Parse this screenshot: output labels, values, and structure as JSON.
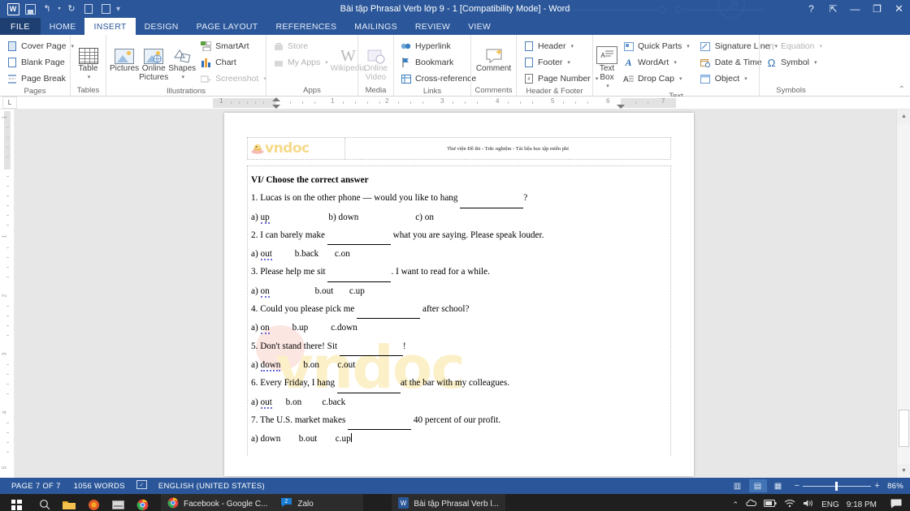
{
  "titlebar": {
    "doc_title": "Bài tập Phrasal Verb lớp 9 - 1 [Compatibility Mode] - Word",
    "qat": [
      {
        "name": "word-logo-icon",
        "label": "W"
      },
      {
        "name": "save-icon",
        "label": ""
      },
      {
        "name": "undo-icon",
        "label": "↰"
      },
      {
        "name": "redo-icon",
        "label": "↻"
      },
      {
        "name": "new-document-icon",
        "label": "🗋"
      },
      {
        "name": "print-preview-icon",
        "label": "🔍"
      },
      {
        "name": "customize-qat-icon",
        "label": "▾"
      }
    ],
    "window_buttons": [
      {
        "name": "help-button",
        "label": "?"
      },
      {
        "name": "ribbon-display-options-button",
        "label": "⇱"
      },
      {
        "name": "minimize-button",
        "label": "—"
      },
      {
        "name": "restore-button",
        "label": "❐"
      },
      {
        "name": "close-button",
        "label": "✕"
      }
    ]
  },
  "tabs": [
    {
      "label": "FILE",
      "active": false
    },
    {
      "label": "HOME",
      "active": false
    },
    {
      "label": "INSERT",
      "active": true
    },
    {
      "label": "DESIGN",
      "active": false
    },
    {
      "label": "PAGE LAYOUT",
      "active": false
    },
    {
      "label": "REFERENCES",
      "active": false
    },
    {
      "label": "MAILINGS",
      "active": false
    },
    {
      "label": "REVIEW",
      "active": false
    },
    {
      "label": "VIEW",
      "active": false
    }
  ],
  "ribbon": {
    "groups": [
      {
        "label": "Pages",
        "items": [
          {
            "label": "Cover Page",
            "caret": true,
            "icon": "cover-page-icon",
            "disabled": false
          },
          {
            "label": "Blank Page",
            "caret": false,
            "icon": "blank-page-icon",
            "disabled": false
          },
          {
            "label": "Page Break",
            "caret": false,
            "icon": "page-break-icon",
            "disabled": false
          }
        ]
      },
      {
        "label": "Tables",
        "items": [
          {
            "label": "Table",
            "caret": true,
            "icon": "table-icon",
            "disabled": false
          }
        ]
      },
      {
        "label": "Illustrations",
        "items": [
          {
            "label": "Pictures",
            "caret": false,
            "icon": "pictures-icon",
            "disabled": false
          },
          {
            "label": "Online Pictures",
            "caret": false,
            "icon": "online-pictures-icon",
            "disabled": false
          },
          {
            "label": "Shapes",
            "caret": true,
            "icon": "shapes-icon",
            "disabled": false
          },
          {
            "label": "SmartArt",
            "caret": false,
            "icon": "smartart-icon",
            "disabled": false
          },
          {
            "label": "Chart",
            "caret": false,
            "icon": "chart-icon",
            "disabled": false
          },
          {
            "label": "Screenshot",
            "caret": true,
            "icon": "screenshot-icon",
            "disabled": true
          }
        ]
      },
      {
        "label": "Apps",
        "items": [
          {
            "label": "Store",
            "caret": false,
            "icon": "store-icon",
            "disabled": true
          },
          {
            "label": "My Apps",
            "caret": true,
            "icon": "my-apps-icon",
            "disabled": true
          },
          {
            "label": "Wikipedia",
            "caret": false,
            "icon": "wikipedia-icon",
            "disabled": true
          }
        ]
      },
      {
        "label": "Media",
        "items": [
          {
            "label": "Online Video",
            "caret": false,
            "icon": "online-video-icon",
            "disabled": true
          }
        ]
      },
      {
        "label": "Links",
        "items": [
          {
            "label": "Hyperlink",
            "caret": false,
            "icon": "hyperlink-icon",
            "disabled": false
          },
          {
            "label": "Bookmark",
            "caret": false,
            "icon": "bookmark-icon",
            "disabled": false
          },
          {
            "label": "Cross-reference",
            "caret": false,
            "icon": "cross-reference-icon",
            "disabled": false
          }
        ]
      },
      {
        "label": "Comments",
        "items": [
          {
            "label": "Comment",
            "caret": false,
            "icon": "comment-icon",
            "disabled": false
          }
        ]
      },
      {
        "label": "Header & Footer",
        "items": [
          {
            "label": "Header",
            "caret": true,
            "icon": "header-icon",
            "disabled": false
          },
          {
            "label": "Footer",
            "caret": true,
            "icon": "footer-icon",
            "disabled": false
          },
          {
            "label": "Page Number",
            "caret": true,
            "icon": "page-number-icon",
            "disabled": false
          }
        ]
      },
      {
        "label": "Text",
        "items": [
          {
            "label": "Text Box",
            "caret": true,
            "icon": "text-box-icon",
            "disabled": false
          },
          {
            "label": "Quick Parts",
            "caret": true,
            "icon": "quick-parts-icon",
            "disabled": false
          },
          {
            "label": "WordArt",
            "caret": true,
            "icon": "wordart-icon",
            "disabled": false
          },
          {
            "label": "Drop Cap",
            "caret": true,
            "icon": "drop-cap-icon",
            "disabled": false
          },
          {
            "label": "Signature Line",
            "caret": true,
            "icon": "signature-line-icon",
            "disabled": false
          },
          {
            "label": "Date & Time",
            "caret": false,
            "icon": "date-time-icon",
            "disabled": false
          },
          {
            "label": "Object",
            "caret": true,
            "icon": "object-icon",
            "disabled": false
          }
        ]
      },
      {
        "label": "Symbols",
        "items": [
          {
            "label": "Equation",
            "caret": true,
            "icon": "equation-icon",
            "disabled": true
          },
          {
            "label": "Symbol",
            "caret": true,
            "icon": "symbol-icon",
            "disabled": false
          }
        ]
      }
    ]
  },
  "ruler": {
    "h_numbers": [
      "1",
      "1",
      "2",
      "3",
      "4",
      "5",
      "6",
      "7"
    ],
    "v_numbers": [
      "1",
      "1",
      "2",
      "3",
      "4",
      "5"
    ]
  },
  "document": {
    "header_logo_text": "vndoc",
    "header_right_text": "Thư viện Đề thi - Trắc nghiệm - Tài liệu học tập miễn phí",
    "watermark_text": "vndoc",
    "lines": [
      {
        "type": "heading",
        "text": "VI/ Choose the correct answer"
      },
      {
        "type": "question",
        "text": "1. Lucas is on the other phone — would you like to hang ____________?"
      },
      {
        "type": "answers",
        "text": "a) up                          b) down                         c) on",
        "sp": "up"
      },
      {
        "type": "question",
        "text": "2. I can barely make ____________ what you are saying. Please speak louder."
      },
      {
        "type": "answers",
        "text": "a) out          b.back       c.on",
        "sp": "out"
      },
      {
        "type": "question",
        "text": "3. Please help me sit ____________. I want to read for a while."
      },
      {
        "type": "answers",
        "text": "a) on                    b.out       c.up",
        "sp": "on"
      },
      {
        "type": "question",
        "text": "4. Could you please pick me ____________ after school?"
      },
      {
        "type": "answers",
        "text": "a) on          b.up          c.down",
        "sp": "on"
      },
      {
        "type": "question",
        "text": "5. Don't stand there! Sit ____________!"
      },
      {
        "type": "answers",
        "text": "a) down          b.on        c.out",
        "sp": "down"
      },
      {
        "type": "question",
        "text": "6. Every Friday, I hang ____________at the bar with my colleagues."
      },
      {
        "type": "answers",
        "text": "a) out      b.on         c.back",
        "sp": "out"
      },
      {
        "type": "question",
        "text": "7. The U.S. market makes ____________ 40 percent of our profit."
      },
      {
        "type": "answers-caret",
        "text": "a) down        b.out        c.up",
        "sp": ""
      }
    ]
  },
  "statusbar": {
    "page": "PAGE 7 OF 7",
    "words": "1056 WORDS",
    "proofing_icon": "spell-check-icon",
    "language": "ENGLISH (UNITED STATES)",
    "views": [
      {
        "name": "read-mode-button",
        "glyph": "▥",
        "active": false
      },
      {
        "name": "print-layout-button",
        "glyph": "▤",
        "active": true
      },
      {
        "name": "web-layout-button",
        "glyph": "▦",
        "active": false
      }
    ],
    "zoom_out": "−",
    "zoom_in": "+",
    "zoom_value": "86%"
  },
  "taskbar": {
    "start_label": "Start",
    "pinned": [
      {
        "name": "search-icon",
        "glyph": "○"
      },
      {
        "name": "file-explorer-icon",
        "glyph": "▭"
      },
      {
        "name": "firefox-icon",
        "glyph": "●"
      },
      {
        "name": "unikey-icon",
        "glyph": "▭"
      },
      {
        "name": "chrome-icon",
        "glyph": "●"
      }
    ],
    "tasks": [
      {
        "name": "taskbar-item-chrome",
        "label": "Facebook - Google C...",
        "icon": "chrome-icon"
      },
      {
        "name": "taskbar-item-zalo",
        "label": "Zalo",
        "icon": "zalo-icon"
      },
      {
        "name": "taskbar-item-word",
        "label": "Bài tập Phrasal Verb l...",
        "icon": "word-icon"
      }
    ],
    "tray": [
      {
        "name": "show-hidden-icons-icon",
        "glyph": "⌃"
      },
      {
        "name": "onedrive-icon",
        "glyph": "☁"
      },
      {
        "name": "battery-icon",
        "glyph": "▭"
      },
      {
        "name": "wifi-icon",
        "glyph": "◗"
      },
      {
        "name": "volume-icon",
        "glyph": "🔊"
      }
    ],
    "language": "ENG",
    "time": "9:18 PM",
    "action_center_icon": "action-center-icon"
  }
}
